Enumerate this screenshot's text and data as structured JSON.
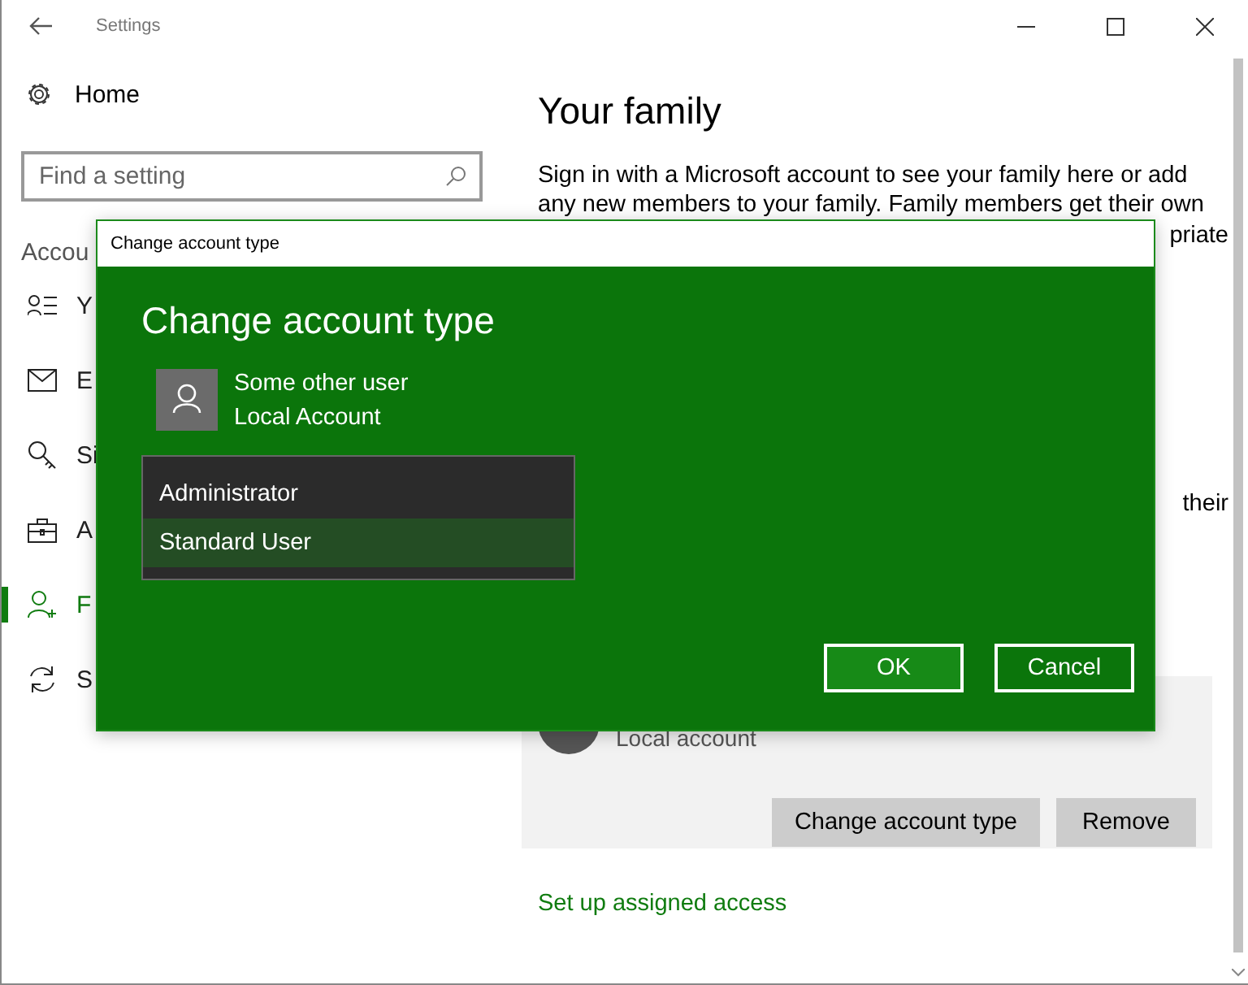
{
  "window": {
    "title": "Settings"
  },
  "sidebar": {
    "home": "Home",
    "search": {
      "placeholder": "Find a setting"
    },
    "section": "Accou",
    "items": [
      {
        "label": "Y",
        "selected": false
      },
      {
        "label": "E",
        "selected": false
      },
      {
        "label": "Si",
        "selected": false
      },
      {
        "label": "A",
        "selected": false
      },
      {
        "label": "F",
        "selected": true
      },
      {
        "label": "S",
        "selected": false
      }
    ]
  },
  "content": {
    "heading": "Your family",
    "paragraph_lines": [
      "Sign in with a Microsoft account to see your family here or add",
      "any new members to your family. Family members get their own",
      "priate"
    ],
    "fragment": "their",
    "account": {
      "type": "Local account",
      "buttons": [
        "Change account type",
        "Remove"
      ]
    },
    "link": "Set up assigned access"
  },
  "dialog": {
    "title": "Change account type",
    "heading": "Change account type",
    "user": {
      "name": "Some other user",
      "type": "Local Account"
    },
    "options": [
      {
        "label": "Administrator",
        "selected": false
      },
      {
        "label": "Standard User",
        "selected": true
      }
    ],
    "buttons": [
      "OK",
      "Cancel"
    ]
  }
}
